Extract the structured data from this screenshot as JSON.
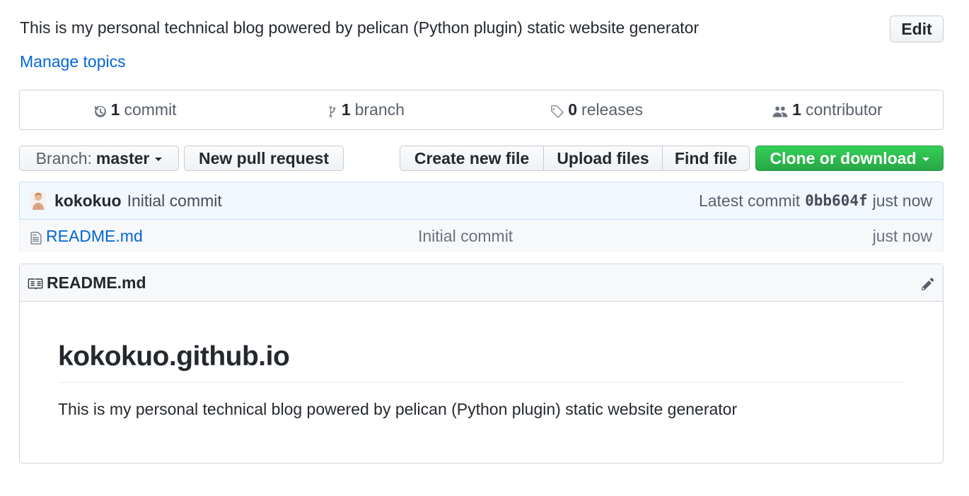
{
  "repo": {
    "description": "This is my personal technical blog powered by pelican (Python plugin) static website generator",
    "edit_label": "Edit",
    "manage_topics_label": "Manage topics"
  },
  "summary": {
    "commits": {
      "count": "1",
      "label": "commit"
    },
    "branches": {
      "count": "1",
      "label": "branch"
    },
    "releases": {
      "count": "0",
      "label": "releases"
    },
    "contributors": {
      "count": "1",
      "label": "contributor"
    }
  },
  "toolbar": {
    "branch_prefix": "Branch:",
    "branch_name": "master",
    "new_pull_request": "New pull request",
    "create_new_file": "Create new file",
    "upload_files": "Upload files",
    "find_file": "Find file",
    "clone_or_download": "Clone or download"
  },
  "latest_commit": {
    "author": "kokokuo",
    "message": "Initial commit",
    "label": "Latest commit",
    "sha": "0bb604f",
    "time": "just now"
  },
  "files": [
    {
      "name": "README.md",
      "message": "Initial commit",
      "age": "just now"
    }
  ],
  "readme": {
    "filename": "README.md",
    "title": "kokokuo.github.io",
    "body": "This is my personal technical blog powered by pelican (Python plugin) static website generator"
  },
  "colors": {
    "link": "#0366d6",
    "primary_button": "#28a745",
    "commit_bar_bg": "#f1f8ff"
  }
}
